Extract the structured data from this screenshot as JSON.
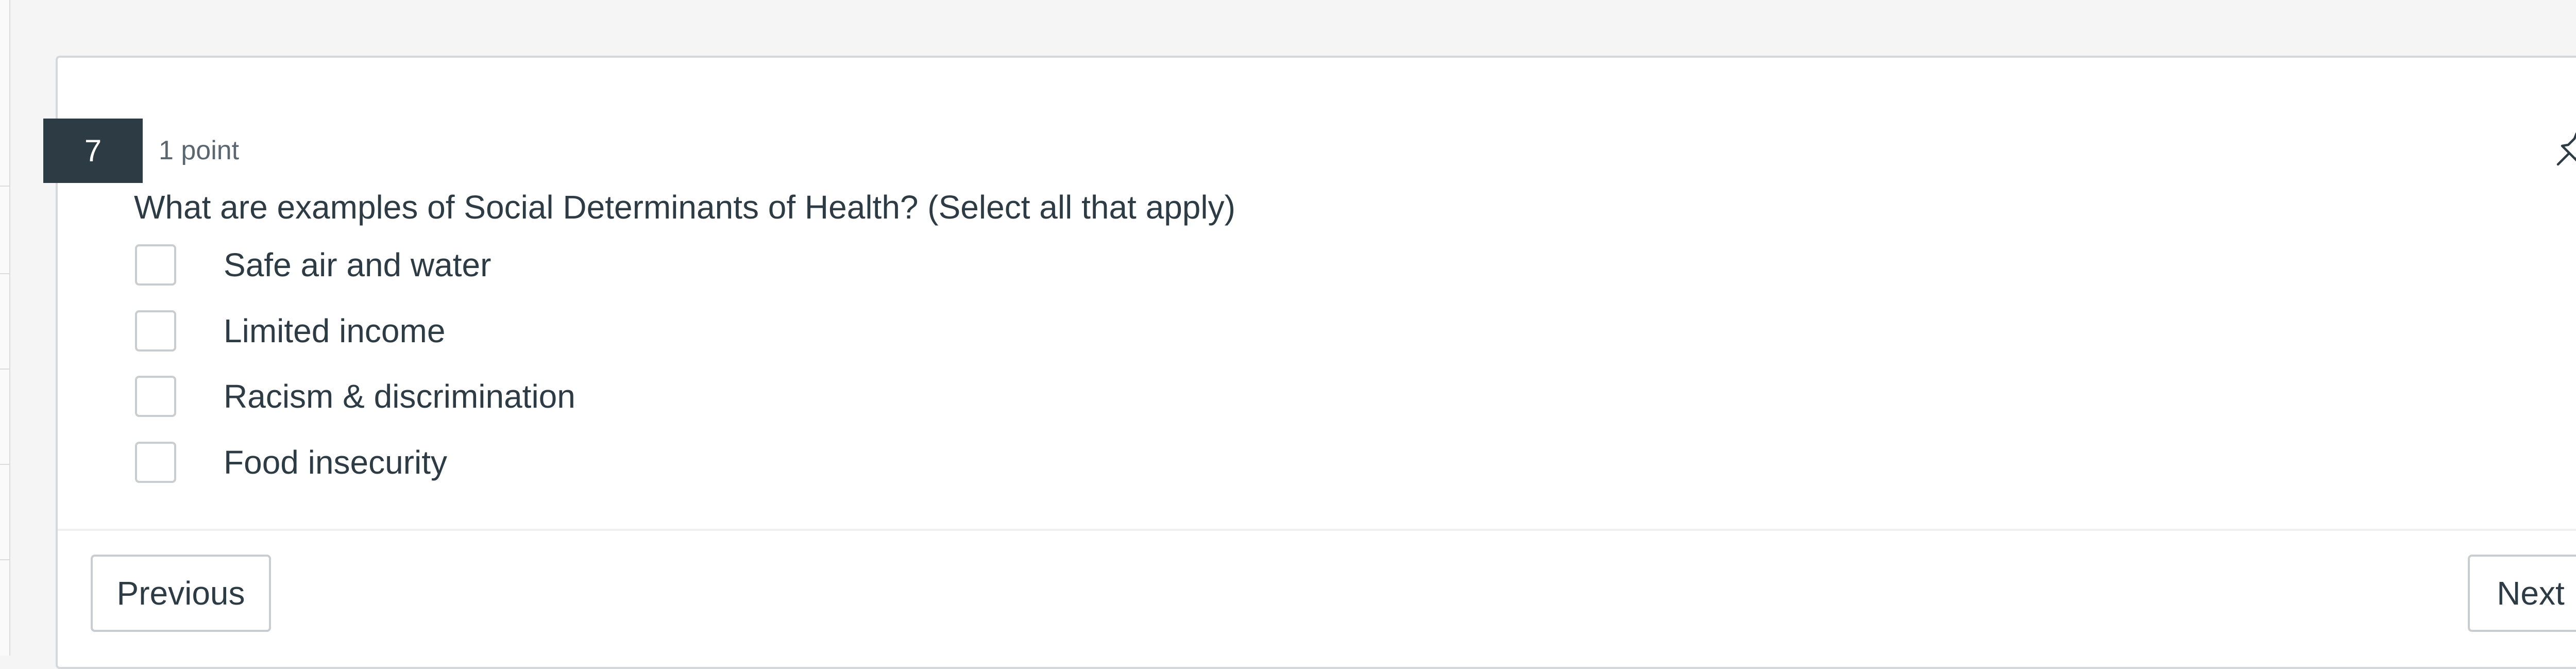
{
  "question": {
    "number": "7",
    "points": "1 point",
    "text": "What are examples of Social Determinants of Health? (Select all that apply)",
    "options": [
      {
        "label": "Safe air and water",
        "checked": false
      },
      {
        "label": "Limited income",
        "checked": false
      },
      {
        "label": "Racism & discrimination",
        "checked": false
      },
      {
        "label": "Food insecurity",
        "checked": false
      }
    ],
    "pin_icon": "pin-icon"
  },
  "navigation": {
    "previous_label": "Previous",
    "next_label": "Next"
  },
  "colors": {
    "badge_background": "#2d3b45",
    "text": "#2d3b45",
    "border": "#c7cdd1"
  }
}
